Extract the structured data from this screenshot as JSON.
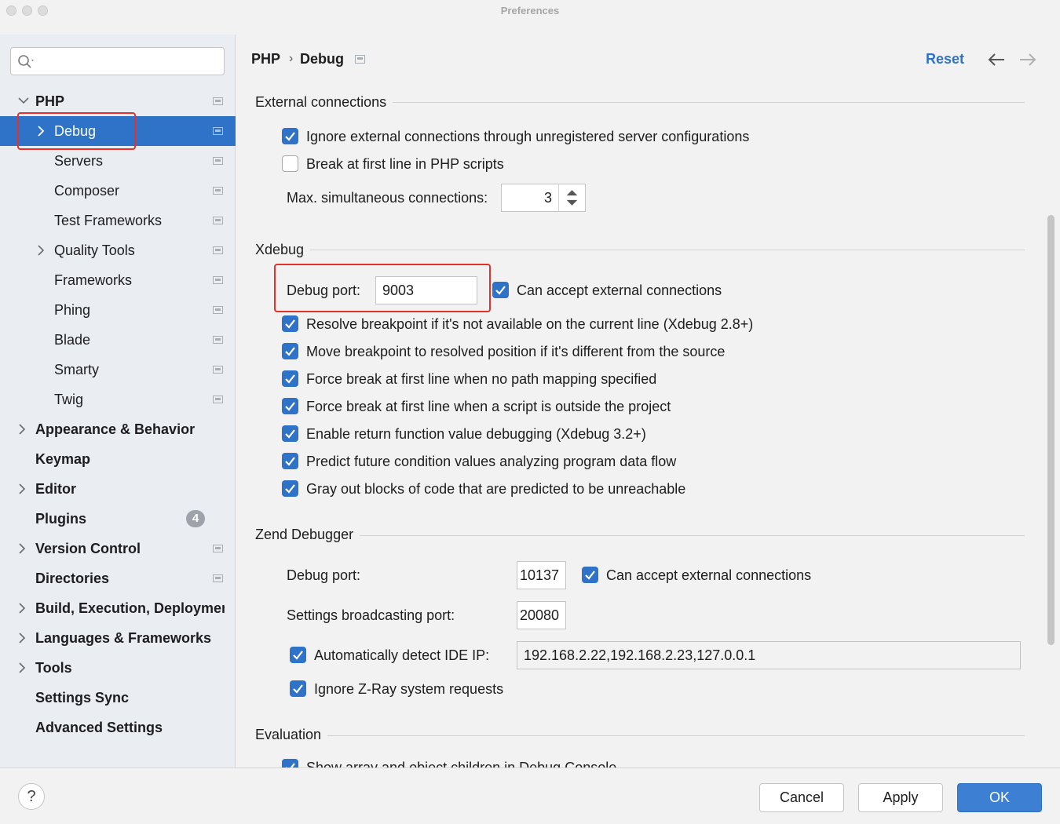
{
  "window": {
    "title": "Preferences"
  },
  "search": {
    "placeholder": ""
  },
  "sidebar": {
    "items": [
      {
        "label": "PHP",
        "expanded": true
      },
      {
        "label": "Debug",
        "selected": true
      },
      {
        "label": "Servers"
      },
      {
        "label": "Composer"
      },
      {
        "label": "Test Frameworks"
      },
      {
        "label": "Quality Tools"
      },
      {
        "label": "Frameworks"
      },
      {
        "label": "Phing"
      },
      {
        "label": "Blade"
      },
      {
        "label": "Smarty"
      },
      {
        "label": "Twig"
      },
      {
        "label": "Appearance & Behavior"
      },
      {
        "label": "Keymap"
      },
      {
        "label": "Editor"
      },
      {
        "label": "Plugins",
        "badge": "4"
      },
      {
        "label": "Version Control"
      },
      {
        "label": "Directories"
      },
      {
        "label": "Build, Execution, Deployment"
      },
      {
        "label": "Languages & Frameworks"
      },
      {
        "label": "Tools"
      },
      {
        "label": "Settings Sync"
      },
      {
        "label": "Advanced Settings"
      }
    ]
  },
  "header": {
    "breadcrumb": [
      "PHP",
      "Debug"
    ],
    "reset_label": "Reset"
  },
  "external": {
    "title": "External connections",
    "ignore_unregistered": {
      "label": "Ignore external connections through unregistered server configurations",
      "checked": true
    },
    "break_first_line": {
      "label": "Break at first line in PHP scripts",
      "checked": false
    },
    "max_connections_label": "Max. simultaneous connections:",
    "max_connections_value": "3"
  },
  "xdebug": {
    "title": "Xdebug",
    "debug_port_label": "Debug port:",
    "debug_port_value": "9003",
    "accept_external": {
      "label": "Can accept external connections",
      "checked": true
    },
    "options": [
      {
        "label": "Resolve breakpoint if it's not available on the current line (Xdebug 2.8+)",
        "checked": true
      },
      {
        "label": "Move breakpoint to resolved position if it's different from the source",
        "checked": true
      },
      {
        "label": "Force break at first line when no path mapping specified",
        "checked": true
      },
      {
        "label": "Force break at first line when a script is outside the project",
        "checked": true
      },
      {
        "label": "Enable return function value debugging (Xdebug 3.2+)",
        "checked": true
      },
      {
        "label": "Predict future condition values analyzing program data flow",
        "checked": true
      },
      {
        "label": "Gray out blocks of code that are predicted to be unreachable",
        "checked": true
      }
    ]
  },
  "zend": {
    "title": "Zend Debugger",
    "debug_port_label": "Debug port:",
    "debug_port_value": "10137",
    "accept_external": {
      "label": "Can accept external connections",
      "checked": true
    },
    "broadcast_port_label": "Settings broadcasting port:",
    "broadcast_port_value": "20080",
    "auto_detect_ip": {
      "label": "Automatically detect IDE IP:",
      "checked": true
    },
    "ide_ip_value": "192.168.2.22,192.168.2.23,127.0.0.1",
    "ignore_zray": {
      "label": "Ignore Z-Ray system requests",
      "checked": true
    }
  },
  "evaluation": {
    "title": "Evaluation",
    "show_array_children": {
      "label": "Show array and object children in Debug Console",
      "checked": true
    }
  },
  "footer": {
    "help_label": "?",
    "cancel_label": "Cancel",
    "apply_label": "Apply",
    "ok_label": "OK"
  },
  "colors": {
    "accent": "#2f73c8",
    "highlight_border": "#e8302a"
  }
}
